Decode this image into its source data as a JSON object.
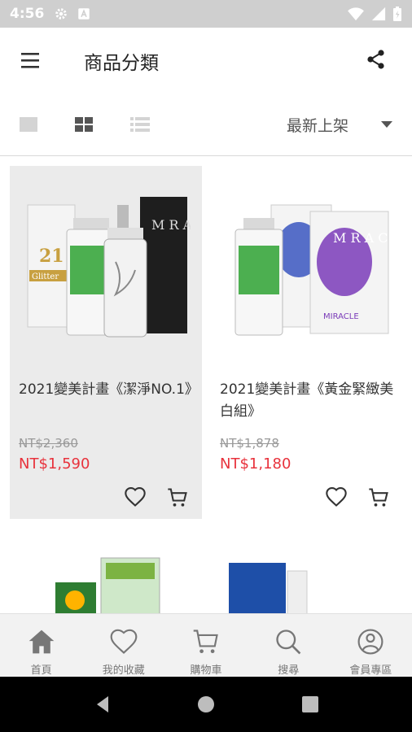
{
  "status_bar": {
    "time": "4:56"
  },
  "app_bar": {
    "title": "商品分類"
  },
  "toolbar": {
    "sort_label": "最新上架"
  },
  "products": [
    {
      "name": "2021變美計畫《潔淨NO.1》",
      "original_price": "NT$2,360",
      "sale_price": "NT$1,590",
      "image_text": {
        "brand_panel": "21",
        "glitter": "Glitter",
        "box_text": "M R A C L E"
      }
    },
    {
      "name": "2021變美計畫《黃金緊緻美白組》",
      "original_price": "NT$1,878",
      "sale_price": "NT$1,180",
      "image_text": {
        "box_text": "M R A C L E",
        "brand": "MIRACLE"
      }
    }
  ],
  "bottom_nav": [
    {
      "label": "首頁",
      "icon": "home-icon"
    },
    {
      "label": "我的收藏",
      "icon": "heart-icon"
    },
    {
      "label": "購物車",
      "icon": "cart-icon"
    },
    {
      "label": "搜尋",
      "icon": "search-icon"
    },
    {
      "label": "會員專區",
      "icon": "user-icon"
    }
  ],
  "colors": {
    "status_bar": "#cfcfcf",
    "sale_price": "#e8323c",
    "card_highlight": "#ebebeb",
    "bottom_nav_bg": "#f2f2f2",
    "icon_gray": "#777777",
    "system_nav": "#000000"
  }
}
